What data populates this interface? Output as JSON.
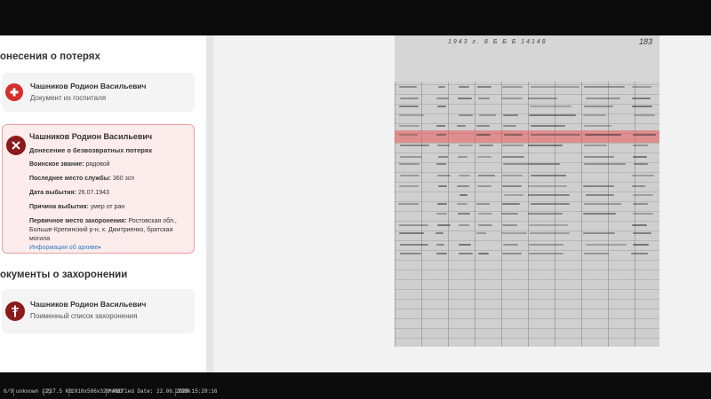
{
  "left_panel": {
    "losses_section_title": "онесения о потерях",
    "card1": {
      "name": "Чашников Родион Васильевич",
      "subtitle": "Документ из госпиталя"
    },
    "card2": {
      "name": "Чашников Родион Васильевич",
      "subtitle": "Донесение о безвозвратных потерях",
      "fields": [
        {
          "label": "Воинское звание:",
          "value": " рядовой"
        },
        {
          "label": "Последнее место службы:",
          "value": " 360 зсп"
        },
        {
          "label": "Дата выбытия:",
          "value": " 26.07.1943"
        },
        {
          "label": "Причина выбытия:",
          "value": " умер от ран"
        },
        {
          "label": "Первичное место захоронения:",
          "value": " Ростовская обл., Больше-Крепинский р-н, х. Дмитриенко, братская могила"
        }
      ],
      "archive_link": "Информация об архиве"
    },
    "burial_section_title": "окументы о захоронении",
    "card3": {
      "name": "Чашников Родион Васильевич",
      "subtitle": "Поименный список захоронения"
    }
  },
  "document": {
    "header_text": "1943 г. 8 Б Б Б 14148",
    "page_number": "183"
  },
  "status_bar": {
    "items": [
      "6/9",
      "unknown (2)",
      "227.5 KB",
      "1018x586x32b PNG",
      "Modified Date: 22.06.2020 15:28:16",
      "200%"
    ]
  },
  "colors": {
    "accent_red": "#c62828",
    "dark_red": "#8b1a1a",
    "link_blue": "#2f7cc0"
  }
}
